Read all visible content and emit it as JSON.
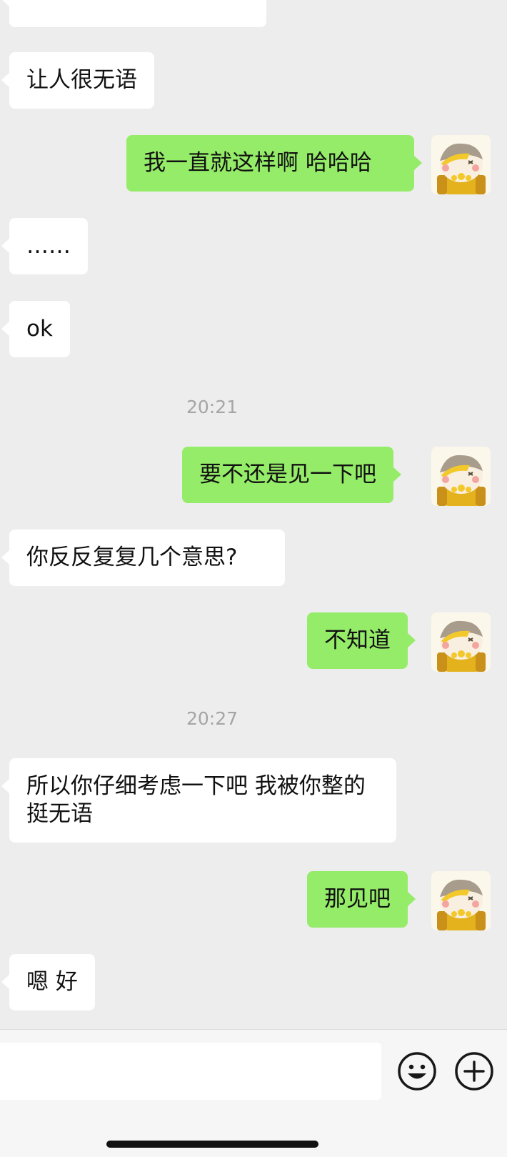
{
  "messages": [
    {
      "side": "in",
      "text": "让人很无语"
    },
    {
      "side": "out",
      "text": "我一直就这样啊 哈哈哈"
    },
    {
      "side": "in",
      "text": "……"
    },
    {
      "side": "in",
      "text": "ok"
    },
    {
      "type": "time",
      "text": "20:21"
    },
    {
      "side": "out",
      "text": "要不还是见一下吧"
    },
    {
      "side": "in",
      "text": "你反反复复几个意思?"
    },
    {
      "side": "out",
      "text": "不知道"
    },
    {
      "type": "time",
      "text": "20:27"
    },
    {
      "side": "in",
      "text": "所以你仔细考虑一下吧 我被你整的挺无语"
    },
    {
      "side": "out",
      "text": "那见吧"
    },
    {
      "side": "in",
      "text": "嗯 好"
    }
  ],
  "input_bar": {
    "message_input_value": "",
    "emoji_icon": "smiley-face-icon",
    "more_icon": "plus-circle-icon"
  },
  "colors": {
    "background": "#ededed",
    "incoming_bubble": "#ffffff",
    "outgoing_bubble": "#95ec69",
    "timestamp": "#a5a5a5"
  }
}
